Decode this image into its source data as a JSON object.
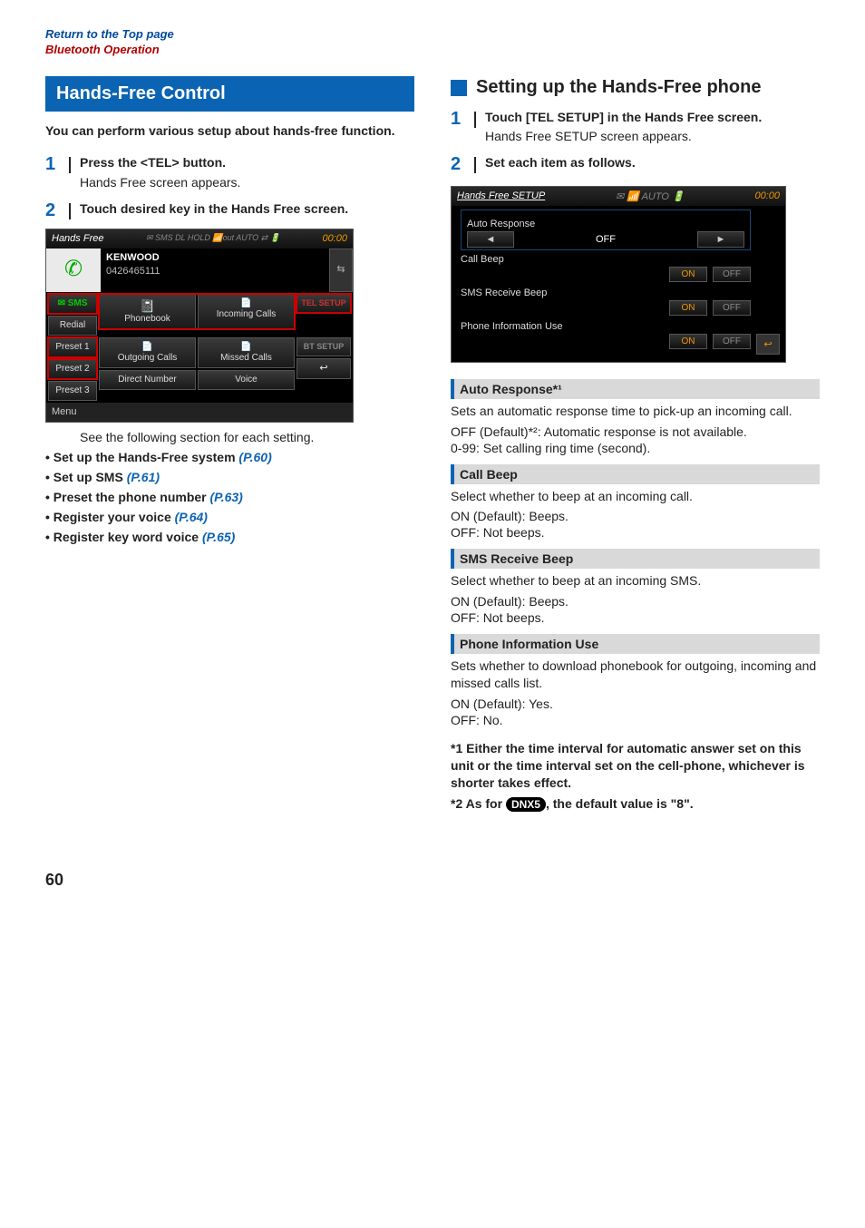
{
  "topLinks": {
    "return": "Return to the Top page",
    "section": "Bluetooth Operation"
  },
  "left": {
    "heading": "Hands-Free Control",
    "intro": "You can perform various setup about hands-free function.",
    "step1": {
      "num": "1",
      "title": "Press the <TEL> button.",
      "sub": "Hands Free screen appears."
    },
    "step2": {
      "num": "2",
      "title": "Touch desired key in the Hands Free screen."
    },
    "screenshot": {
      "title": "Hands Free",
      "statusIcons": "✉ SMS DL HOLD  📶out  AUTO ⇄  🔋",
      "time": "00:00",
      "contactName": "KENWOOD",
      "contactNumber": "0426465111",
      "sms": "SMS",
      "redial": "Redial",
      "phonebook": "Phonebook",
      "incoming": "Incoming Calls",
      "preset1": "Preset 1",
      "preset2": "Preset 2",
      "preset3": "Preset 3",
      "outgoing": "Outgoing Calls",
      "missed": "Missed Calls",
      "direct": "Direct Number",
      "voice": "Voice",
      "telsetup": "TEL SETUP",
      "btsetup": "BT SETUP",
      "back": "↩",
      "menu": "Menu",
      "swap": "⇆",
      "avatar": "✆"
    },
    "seeFollowing": "See the following section for each setting.",
    "bullets": [
      {
        "label": "Set up the Hands-Free system",
        "link": "(P.60)"
      },
      {
        "label": "Set up SMS",
        "link": "(P.61)"
      },
      {
        "label": "Preset the phone number",
        "link": "(P.63)"
      },
      {
        "label": "Register your voice",
        "link": "(P.64)"
      },
      {
        "label": "Register key word voice",
        "link": "(P.65)"
      }
    ]
  },
  "right": {
    "subheading": "Setting up the Hands-Free phone",
    "step1": {
      "num": "1",
      "title": "Touch [TEL SETUP] in the Hands Free screen.",
      "sub": "Hands Free SETUP screen appears."
    },
    "step2": {
      "num": "2",
      "title": "Set each item as follows."
    },
    "screenshot": {
      "title": "Hands Free SETUP",
      "statusIcons": "✉   📶   AUTO  🔋",
      "time": "00:00",
      "autoResponse": "Auto Response",
      "autoValue": "OFF",
      "callBeep": "Call Beep",
      "smsBeep": "SMS Receive Beep",
      "phoneInfo": "Phone Information Use",
      "on": "ON",
      "off": "OFF",
      "back": "↩"
    },
    "settings": {
      "autoResponse": {
        "header": "Auto Response*¹",
        "desc": "Sets an automatic response time to pick-up an incoming call.",
        "opt1k": "OFF (Default)*²",
        "opt1v": ": Automatic response is not available.",
        "opt2k": "0-99",
        "opt2v": ": Set calling ring time (second)."
      },
      "callBeep": {
        "header": "Call Beep",
        "desc": "Select whether to beep at an incoming call.",
        "opt1k": "ON (Default)",
        "opt1v": ": Beeps.",
        "opt2k": "OFF",
        "opt2v": ": Not beeps."
      },
      "smsBeep": {
        "header": "SMS Receive Beep",
        "desc": "Select whether to beep at an incoming SMS.",
        "opt1k": "ON (Default)",
        "opt1v": ": Beeps.",
        "opt2k": "OFF",
        "opt2v": ": Not beeps."
      },
      "phoneInfo": {
        "header": "Phone Information Use",
        "desc": "Sets whether to download phonebook for outgoing, incoming and missed calls list.",
        "opt1k": "ON (Default)",
        "opt1v": ": Yes.",
        "opt2k": "OFF",
        "opt2v": ": No."
      }
    },
    "footnotes": {
      "n1": "*1 Either the time interval for automatic answer set on this unit or the time interval set on the cell-phone, whichever is shorter takes effect.",
      "n2a": "*2 As for ",
      "n2badge": "DNX5",
      "n2b": ", the default value is \"8\"."
    }
  },
  "pageNumber": "60"
}
